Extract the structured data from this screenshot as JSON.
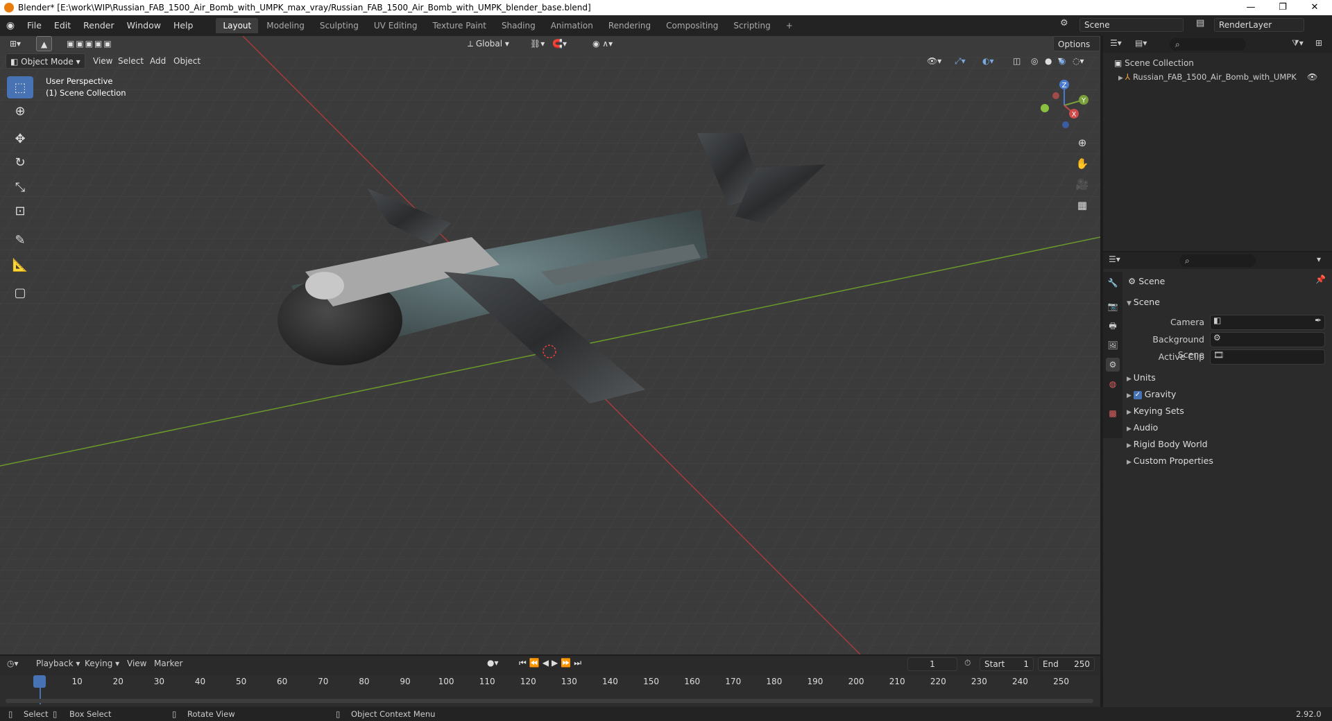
{
  "window": {
    "title": "Blender* [E:\\work\\WIP\\Russian_FAB_1500_Air_Bomb_with_UMPK_max_vray/Russian_FAB_1500_Air_Bomb_with_UMPK_blender_base.blend]",
    "minimize": "—",
    "restore": "❐",
    "close": "✕"
  },
  "menu": {
    "items": [
      "File",
      "Edit",
      "Render",
      "Window",
      "Help"
    ],
    "workspaces": [
      "Layout",
      "Modeling",
      "Sculpting",
      "UV Editing",
      "Texture Paint",
      "Shading",
      "Animation",
      "Rendering",
      "Compositing",
      "Scripting"
    ],
    "add_workspace": "+",
    "scene_name": "Scene",
    "render_layer": "RenderLayer"
  },
  "viewport": {
    "mode": "Object Mode",
    "menus": [
      "View",
      "Select",
      "Add",
      "Object"
    ],
    "transform_orientation": "Global",
    "options": "Options",
    "perspective_label": "User Perspective",
    "collection_label": "(1) Scene Collection",
    "gizmo": {
      "x": "X",
      "y": "Y",
      "z": "Z"
    }
  },
  "outliner": {
    "root": "Scene Collection",
    "items": [
      "Russian_FAB_1500_Air_Bomb_with_UMPK"
    ]
  },
  "properties": {
    "context": "Scene",
    "panel": "Scene",
    "fields": [
      {
        "label": "Camera"
      },
      {
        "label": "Background Scene"
      },
      {
        "label": "Active Clip"
      }
    ],
    "sections": [
      "Units",
      "Gravity",
      "Keying Sets",
      "Audio",
      "Rigid Body World",
      "Custom Properties"
    ],
    "gravity_enabled": true
  },
  "timeline": {
    "menus": [
      "Playback",
      "Keying",
      "View",
      "Marker"
    ],
    "current_frame": "1",
    "start_label": "Start",
    "start": "1",
    "end_label": "End",
    "end": "250",
    "ruler": [
      "1",
      "10",
      "20",
      "30",
      "40",
      "50",
      "60",
      "70",
      "80",
      "90",
      "100",
      "110",
      "120",
      "130",
      "140",
      "150",
      "160",
      "170",
      "180",
      "190",
      "200",
      "210",
      "220",
      "230",
      "240",
      "250"
    ]
  },
  "statusbar": {
    "select": "Select",
    "box_select": "Box Select",
    "rotate_view": "Rotate View",
    "context_menu": "Object Context Menu",
    "version": "2.92.0"
  }
}
